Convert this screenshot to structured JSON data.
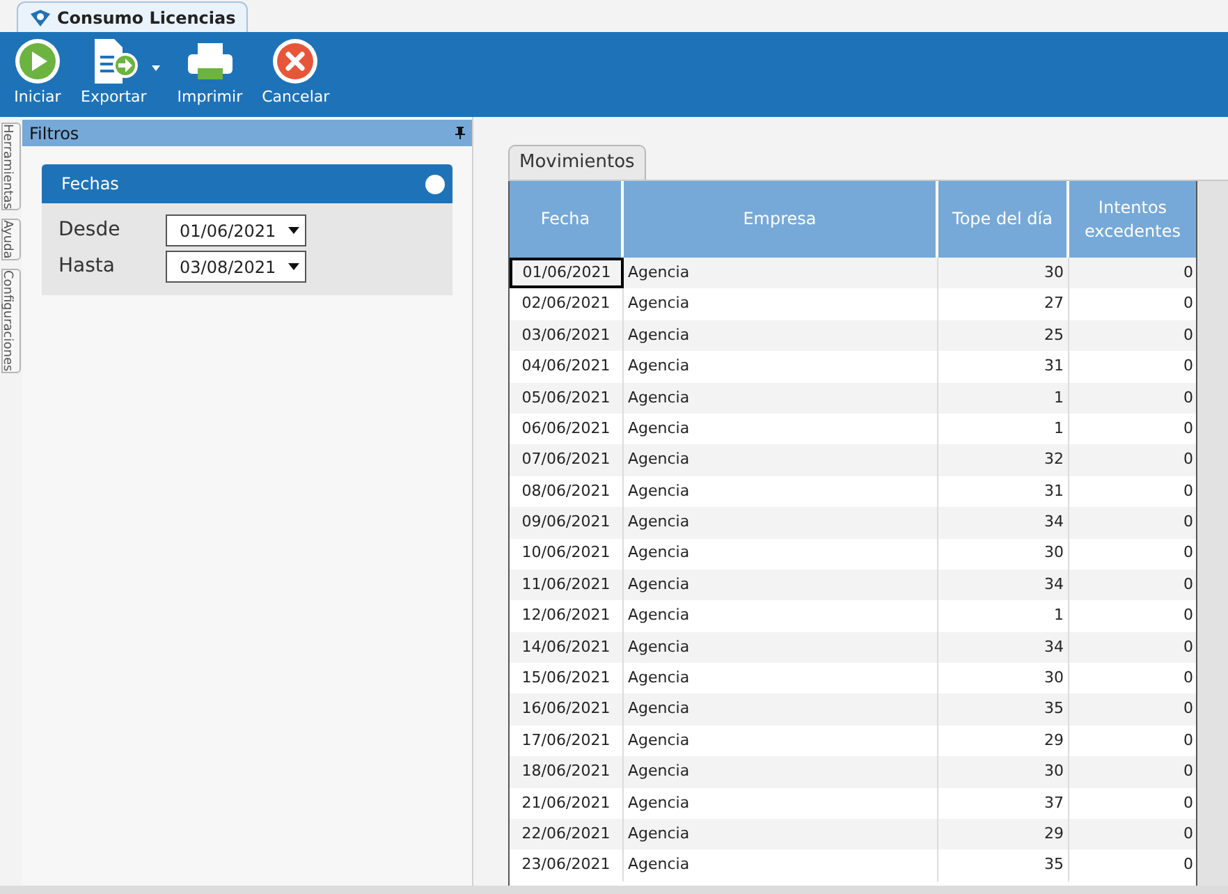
{
  "window": {
    "title": "Consumo Licencias"
  },
  "toolbar": [
    {
      "kind": "play",
      "label": "Iniciar",
      "has_menu": false
    },
    {
      "kind": "export",
      "label": "Exportar",
      "has_menu": true
    },
    {
      "kind": "print",
      "label": "Imprimir",
      "has_menu": false
    },
    {
      "kind": "cancel",
      "label": "Cancelar",
      "has_menu": false
    }
  ],
  "side_tabs": [
    "Herramientas",
    "Ayuda",
    "Configuraciones"
  ],
  "filters": {
    "title": "Filtros",
    "group": {
      "title": "Fechas",
      "fields": [
        {
          "label": "Desde",
          "value": "01/06/2021"
        },
        {
          "label": "Hasta",
          "value": "03/08/2021"
        }
      ]
    }
  },
  "tabs": [
    {
      "label": "Movimientos",
      "selected": true
    }
  ],
  "table": {
    "columns": [
      "Fecha",
      "Empresa",
      "Tope del día",
      "Intentos excedentes"
    ],
    "rows": [
      {
        "cells": [
          "01/06/2021",
          "Agencia",
          "30",
          "0"
        ],
        "selected": true
      },
      {
        "cells": [
          "02/06/2021",
          "Agencia",
          "27",
          "0"
        ],
        "selected": false
      },
      {
        "cells": [
          "03/06/2021",
          "Agencia",
          "25",
          "0"
        ],
        "selected": false
      },
      {
        "cells": [
          "04/06/2021",
          "Agencia",
          "31",
          "0"
        ],
        "selected": false
      },
      {
        "cells": [
          "05/06/2021",
          "Agencia",
          "1",
          "0"
        ],
        "selected": false
      },
      {
        "cells": [
          "06/06/2021",
          "Agencia",
          "1",
          "0"
        ],
        "selected": false
      },
      {
        "cells": [
          "07/06/2021",
          "Agencia",
          "32",
          "0"
        ],
        "selected": false
      },
      {
        "cells": [
          "08/06/2021",
          "Agencia",
          "31",
          "0"
        ],
        "selected": false
      },
      {
        "cells": [
          "09/06/2021",
          "Agencia",
          "34",
          "0"
        ],
        "selected": false
      },
      {
        "cells": [
          "10/06/2021",
          "Agencia",
          "30",
          "0"
        ],
        "selected": false
      },
      {
        "cells": [
          "11/06/2021",
          "Agencia",
          "34",
          "0"
        ],
        "selected": false
      },
      {
        "cells": [
          "12/06/2021",
          "Agencia",
          "1",
          "0"
        ],
        "selected": false
      },
      {
        "cells": [
          "14/06/2021",
          "Agencia",
          "34",
          "0"
        ],
        "selected": false
      },
      {
        "cells": [
          "15/06/2021",
          "Agencia",
          "30",
          "0"
        ],
        "selected": false
      },
      {
        "cells": [
          "16/06/2021",
          "Agencia",
          "35",
          "0"
        ],
        "selected": false
      },
      {
        "cells": [
          "17/06/2021",
          "Agencia",
          "29",
          "0"
        ],
        "selected": false
      },
      {
        "cells": [
          "18/06/2021",
          "Agencia",
          "30",
          "0"
        ],
        "selected": false
      },
      {
        "cells": [
          "21/06/2021",
          "Agencia",
          "37",
          "0"
        ],
        "selected": false
      },
      {
        "cells": [
          "22/06/2021",
          "Agencia",
          "29",
          "0"
        ],
        "selected": false
      },
      {
        "cells": [
          "23/06/2021",
          "Agencia",
          "35",
          "0"
        ],
        "selected": false
      }
    ]
  }
}
